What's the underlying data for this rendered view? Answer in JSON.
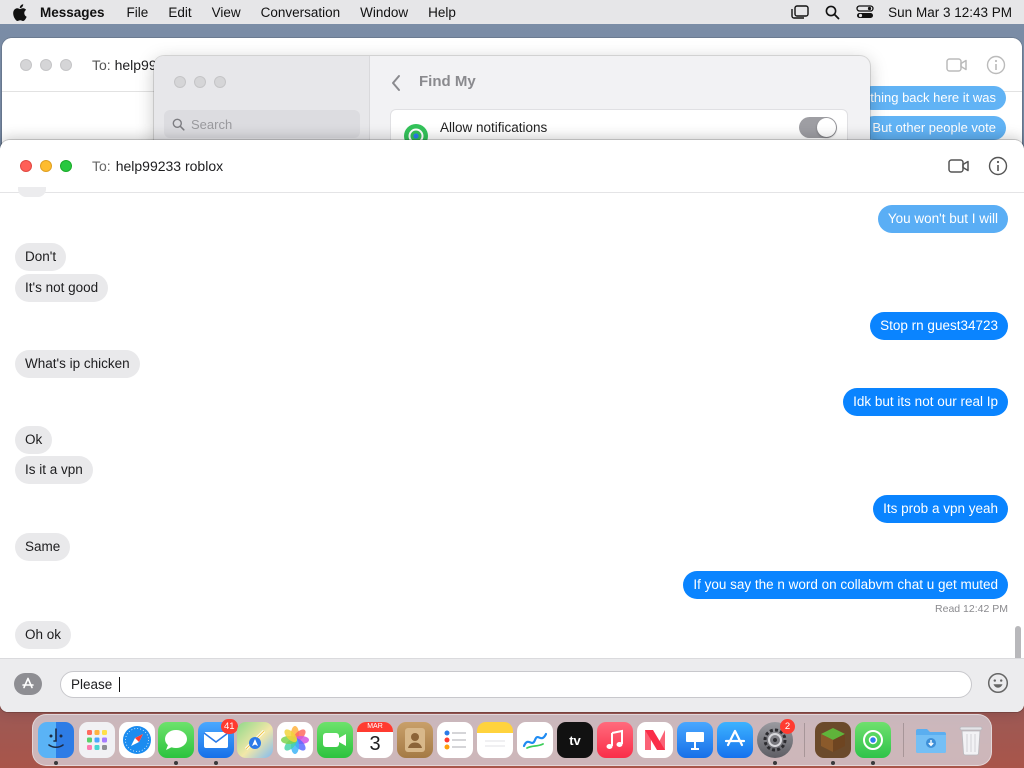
{
  "menubar": {
    "app_name": "Messages",
    "items": [
      "File",
      "Edit",
      "View",
      "Conversation",
      "Window",
      "Help"
    ],
    "clock": "Sun Mar 3  12:43 PM"
  },
  "bg_window": {
    "to_label": "To:",
    "recipient": "help99",
    "partial_messages": [
      "thing back here it was",
      "But other people vote"
    ]
  },
  "find_my": {
    "search_placeholder": "Search",
    "title": "Find My",
    "setting_label": "Allow notifications",
    "toggle_on": true
  },
  "conversation": {
    "to_label": "To:",
    "recipient": "help99233 roblox",
    "messages": [
      {
        "dir": "out",
        "text": "You won't but I will"
      },
      {
        "dir": "in",
        "text": "Don't"
      },
      {
        "dir": "in",
        "text": "It's not good"
      },
      {
        "dir": "out",
        "text": "Stop rn guest34723"
      },
      {
        "dir": "in",
        "text": "What's ip chicken"
      },
      {
        "dir": "out",
        "text": "Idk but its not our real Ip"
      },
      {
        "dir": "in",
        "text": "Ok"
      },
      {
        "dir": "in",
        "text": "Is it a vpn"
      },
      {
        "dir": "out",
        "text": "Its prob a vpn yeah"
      },
      {
        "dir": "in",
        "text": "Same"
      },
      {
        "dir": "out",
        "text": "If you say the n word on collabvm chat u get muted"
      },
      {
        "dir": "in",
        "text": "Oh ok"
      }
    ],
    "read_receipt": {
      "label": "Read",
      "time": "12:42 PM"
    }
  },
  "composer": {
    "draft": "Please "
  },
  "dock": {
    "apps": [
      "Finder",
      "Launchpad",
      "Safari",
      "Messages",
      "Mail",
      "Maps",
      "Photos",
      "FaceTime",
      "Calendar",
      "Contacts",
      "Reminders",
      "Notes",
      "Freeform",
      "TV",
      "Music",
      "News",
      "Keynote",
      "App Store",
      "System Settings",
      "Minecraft",
      "Find My",
      "Downloads",
      "Trash"
    ],
    "mail_badge": "41",
    "settings_badge": "2",
    "calendar_month": "MAR",
    "calendar_day": "3",
    "tv_label": "tv"
  },
  "colors": {
    "outgoing_bubble": "#0a84ff",
    "incoming_bubble": "#e9e9eb",
    "menubar_bg": "#e6e6e8"
  }
}
